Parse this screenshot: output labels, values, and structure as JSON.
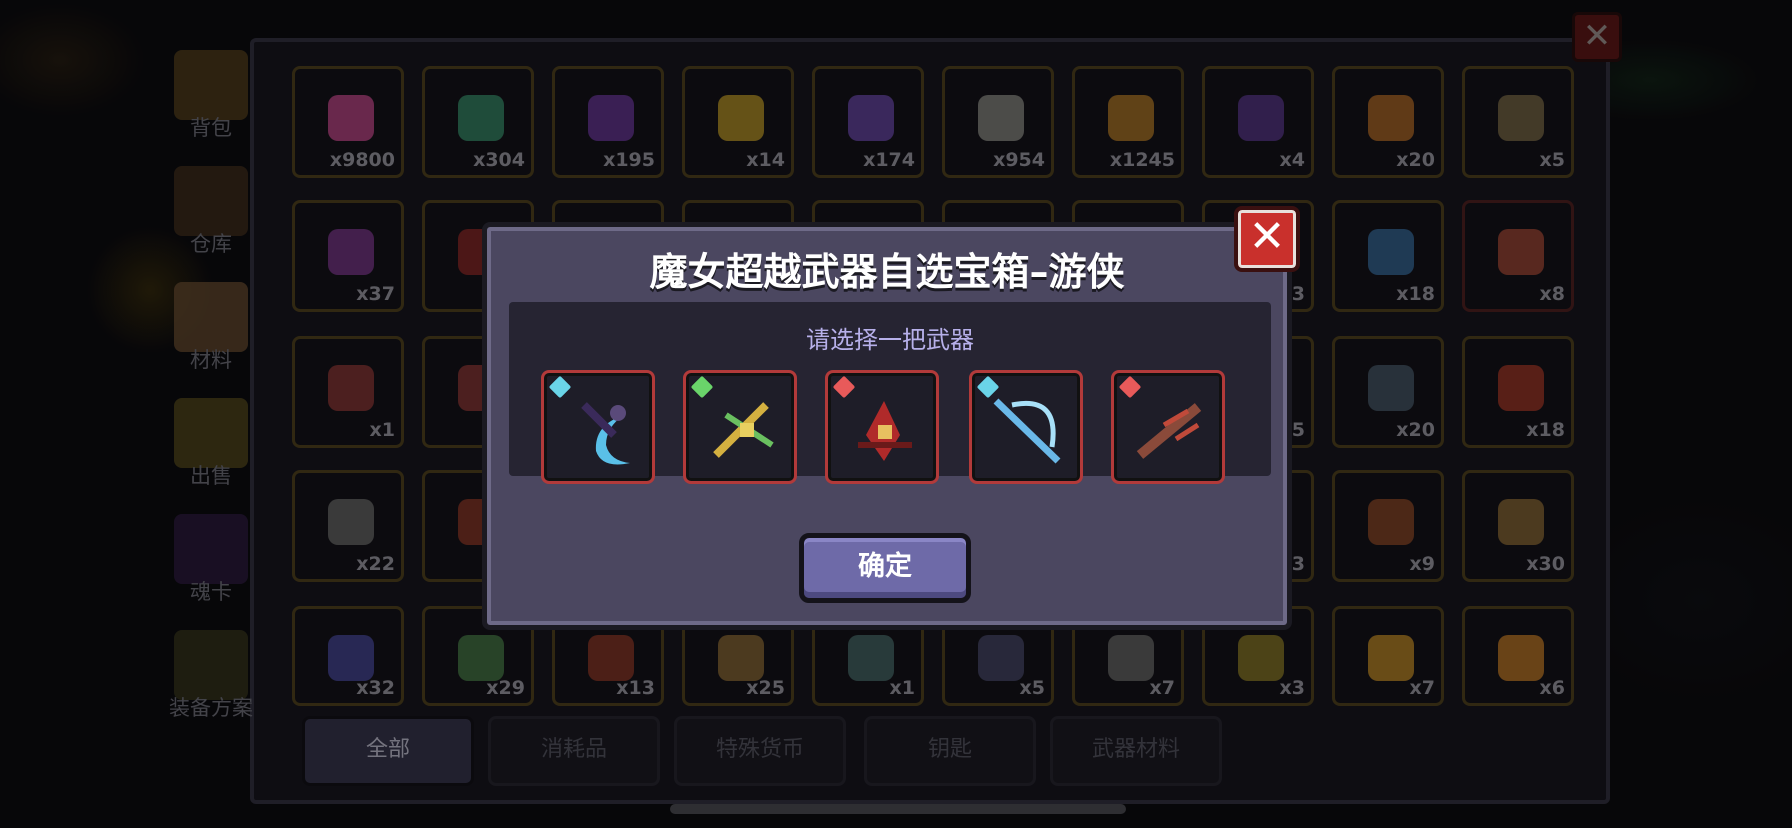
{
  "inventory": {
    "close_label": "✕",
    "side_tabs": [
      {
        "label": "背包",
        "icon": "backpack-chest-icon"
      },
      {
        "label": "仓库",
        "icon": "storage-chest-icon"
      },
      {
        "label": "材料",
        "icon": "materials-crate-icon"
      },
      {
        "label": "出售",
        "icon": "sell-gold-icon"
      },
      {
        "label": "魂卡",
        "icon": "soul-card-icon"
      },
      {
        "label": "装备方案",
        "icon": "equipment-plan-icon"
      }
    ],
    "grid_rows": [
      [
        {
          "count": "x9800",
          "color": "#c04a8a"
        },
        {
          "count": "x304",
          "color": "#3a8a6a"
        },
        {
          "count": "x195",
          "color": "#6a3a9a"
        },
        {
          "count": "x14",
          "color": "#b8952a"
        },
        {
          "count": "x174",
          "color": "#6a4aa8"
        },
        {
          "count": "x954",
          "color": "#8a8a86"
        },
        {
          "count": "x1245",
          "color": "#b0782a"
        },
        {
          "count": "x4",
          "color": "#5a3a8a"
        },
        {
          "count": "x20",
          "color": "#b06a2a"
        },
        {
          "count": "x5",
          "color": "#7a6a4a"
        }
      ],
      [
        {
          "count": "x37",
          "color": "#7a3a8a"
        },
        {
          "count": "",
          "color": "#8a2a2a"
        },
        {
          "count": "",
          "color": "#222"
        },
        {
          "count": "",
          "color": "#222"
        },
        {
          "count": "",
          "color": "#222"
        },
        {
          "count": "",
          "color": "#222"
        },
        {
          "count": "",
          "color": "#222"
        },
        {
          "count": "3",
          "color": "#222"
        },
        {
          "count": "x18",
          "color": "#3a6a9a"
        },
        {
          "count": "x8",
          "color": "#a04a3a",
          "red": true
        }
      ],
      [
        {
          "count": "x1",
          "color": "#8a3a3a"
        },
        {
          "count": "",
          "color": "#8a3a3a"
        },
        {
          "count": "",
          "color": "#222"
        },
        {
          "count": "",
          "color": "#222"
        },
        {
          "count": "",
          "color": "#222"
        },
        {
          "count": "",
          "color": "#222"
        },
        {
          "count": "",
          "color": "#222"
        },
        {
          "count": "5",
          "color": "#222"
        },
        {
          "count": "x20",
          "color": "#4a5a6a"
        },
        {
          "count": "x18",
          "color": "#a03a2a"
        }
      ],
      [
        {
          "count": "x22",
          "color": "#6a6a6a"
        },
        {
          "count": "",
          "color": "#8a3a2a"
        },
        {
          "count": "",
          "color": "#222"
        },
        {
          "count": "",
          "color": "#222"
        },
        {
          "count": "",
          "color": "#222"
        },
        {
          "count": "",
          "color": "#222"
        },
        {
          "count": "",
          "color": "#222"
        },
        {
          "count": "3",
          "color": "#222"
        },
        {
          "count": "x9",
          "color": "#8a4a2a"
        },
        {
          "count": "x30",
          "color": "#8a6a3a"
        }
      ],
      [
        {
          "count": "x32",
          "color": "#4a4a9a"
        },
        {
          "count": "x29",
          "color": "#4a7a4a"
        },
        {
          "count": "x13",
          "color": "#8a3a2a"
        },
        {
          "count": "x25",
          "color": "#8a6a3a"
        },
        {
          "count": "x1",
          "color": "#4a6a6a"
        },
        {
          "count": "x5",
          "color": "#4a4a6a"
        },
        {
          "count": "x7",
          "color": "#6a6a6a"
        },
        {
          "count": "x3",
          "color": "#8a7a2a"
        },
        {
          "count": "x7",
          "color": "#c08a2a"
        },
        {
          "count": "x6",
          "color": "#c07a2a"
        }
      ]
    ],
    "filter_tabs": [
      "全部",
      "消耗品",
      "特殊货币",
      "钥匙",
      "武器材料"
    ],
    "active_filter": 0
  },
  "dialog": {
    "title": "魔女超越武器自选宝箱–游侠",
    "subtitle": "请选择一把武器",
    "confirm_label": "确定",
    "close_label": "✕",
    "weapons": [
      {
        "icon": "crescent-scythe-icon",
        "gem_color": "#6ad4e8"
      },
      {
        "icon": "golden-crossbow-icon",
        "gem_color": "#6ad46a"
      },
      {
        "icon": "crimson-blade-icon",
        "gem_color": "#e85a5a"
      },
      {
        "icon": "frost-bow-icon",
        "gem_color": "#6ad4e8"
      },
      {
        "icon": "bone-launcher-icon",
        "gem_color": "#e85a5a"
      }
    ]
  }
}
